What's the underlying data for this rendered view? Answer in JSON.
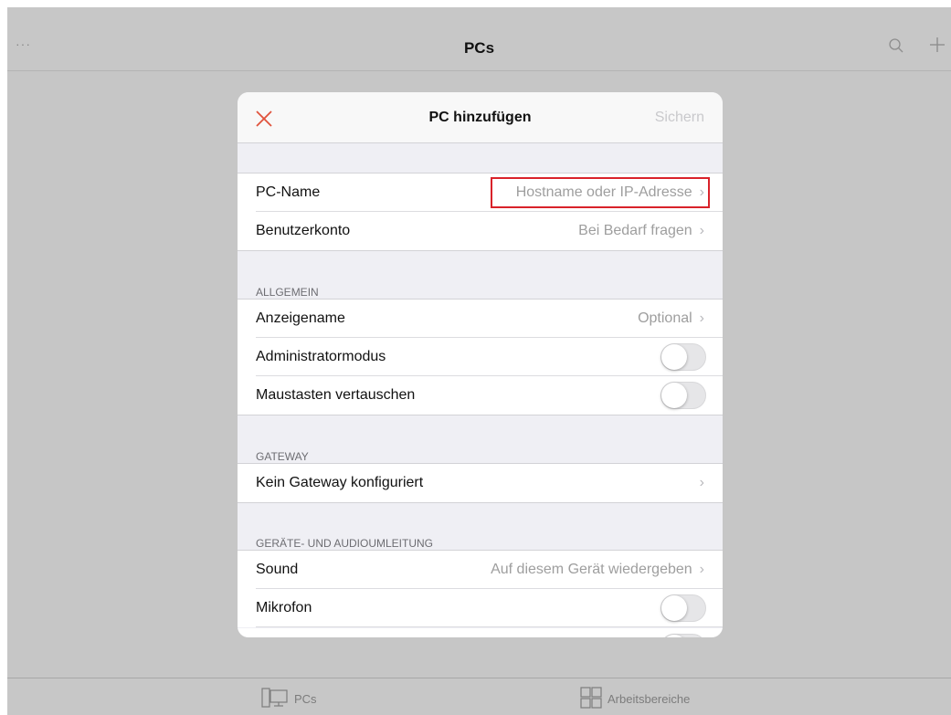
{
  "topbar": {
    "more_label": "···",
    "title": "PCs"
  },
  "bottombar": {
    "tabs": [
      {
        "label": "PCs",
        "icon": "monitor-icon"
      },
      {
        "label": "Arbeitsbereiche",
        "icon": "grid-icon"
      }
    ]
  },
  "modal": {
    "title": "PC hinzufügen",
    "save_label": "Sichern",
    "close_icon": "close-icon",
    "close_color": "#e0533d",
    "pc_name": {
      "label": "PC-Name",
      "value": "Hostname oder IP-Adresse"
    },
    "user_account": {
      "label": "Benutzerkonto",
      "value": "Bei Bedarf fragen"
    },
    "general": {
      "header": "ALLGEMEIN",
      "display_name": {
        "label": "Anzeigename",
        "value": "Optional"
      },
      "admin_mode": {
        "label": "Administratormodus",
        "on": false
      },
      "swap_mouse": {
        "label": "Maustasten vertauschen",
        "on": false
      }
    },
    "gateway": {
      "header": "GATEWAY",
      "item": {
        "label": "Kein Gateway konfiguriert"
      }
    },
    "redirect": {
      "header": "GERÄTE- UND AUDIOUMLEITUNG",
      "sound": {
        "label": "Sound",
        "value": "Auf diesem Gerät wiedergeben"
      },
      "microphone": {
        "label": "Mikrofon",
        "on": false
      }
    }
  }
}
